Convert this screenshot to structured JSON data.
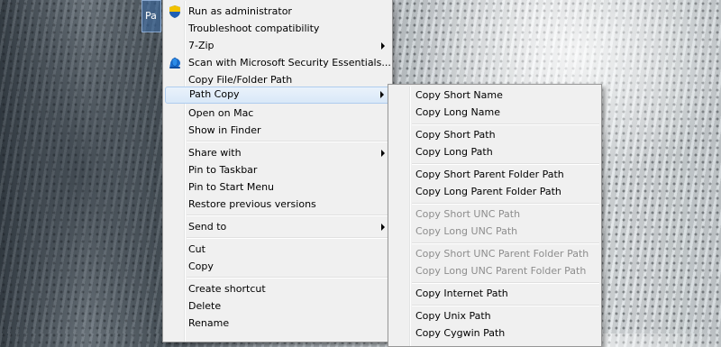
{
  "desktop": {
    "icon_label": "Pa"
  },
  "context_menu": {
    "items": [
      {
        "label": "Run as administrator",
        "icon": "uac-shield-icon"
      },
      {
        "label": "Troubleshoot compatibility"
      },
      {
        "label": "7-Zip",
        "submenu": true
      },
      {
        "label": "Scan with Microsoft Security Essentials...",
        "icon": "security-essentials-icon"
      },
      {
        "label": "Copy File/Folder Path"
      },
      {
        "label": "Path Copy",
        "submenu": true,
        "highlighted": true
      },
      {
        "label": "Open on Mac"
      },
      {
        "label": "Show in Finder"
      },
      {
        "label": "Share with",
        "submenu": true
      },
      {
        "label": "Pin to Taskbar"
      },
      {
        "label": "Pin to Start Menu"
      },
      {
        "label": "Restore previous versions"
      },
      {
        "label": "Send to",
        "submenu": true
      },
      {
        "label": "Cut"
      },
      {
        "label": "Copy"
      },
      {
        "label": "Create shortcut"
      },
      {
        "label": "Delete"
      },
      {
        "label": "Rename"
      }
    ]
  },
  "path_copy_submenu": {
    "items": [
      {
        "label": "Copy Short Name",
        "enabled": true
      },
      {
        "label": "Copy Long Name",
        "enabled": true
      },
      {
        "label": "Copy Short Path",
        "enabled": true
      },
      {
        "label": "Copy Long Path",
        "enabled": true
      },
      {
        "label": "Copy Short Parent Folder Path",
        "enabled": true
      },
      {
        "label": "Copy Long Parent Folder Path",
        "enabled": true
      },
      {
        "label": "Copy Short UNC Path",
        "enabled": false
      },
      {
        "label": "Copy Long UNC Path",
        "enabled": false
      },
      {
        "label": "Copy Short UNC Parent Folder Path",
        "enabled": false
      },
      {
        "label": "Copy Long UNC Parent Folder Path",
        "enabled": false
      },
      {
        "label": "Copy Internet Path",
        "enabled": true
      },
      {
        "label": "Copy Unix Path",
        "enabled": true
      },
      {
        "label": "Copy Cygwin Path",
        "enabled": true
      }
    ]
  },
  "colors": {
    "menu_background": "#f0f0f0",
    "highlight_background": "#d9e8f8",
    "highlight_border": "#aeccee",
    "disabled_text": "#8d8d8d"
  }
}
